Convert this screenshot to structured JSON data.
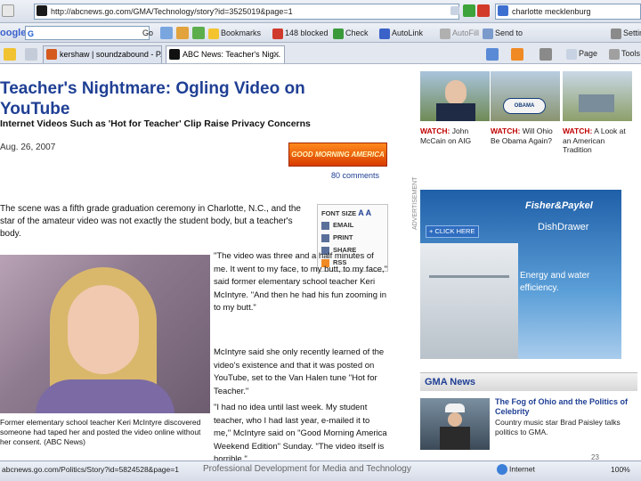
{
  "browser": {
    "url": "http://abcnews.go.com/GMA/Technology/story?id=3525019&page=1",
    "search_text": "charlotte mecklenburg",
    "toolbar": {
      "google_label": "oogle",
      "go_label": "Go",
      "bookmarks_label": "Bookmarks",
      "blocked_label": "148 blocked",
      "check_label": "Check",
      "autolink_label": "AutoLink",
      "autofill_label": "AutoFill",
      "sendto_label": "Send to",
      "settings_label": "Settin"
    },
    "tabs": [
      {
        "label": "kershaw | soundzabound - P..."
      },
      {
        "label": "ABC News: Teacher's Nig..."
      }
    ],
    "page_label": "Page",
    "tools_label": "Tools"
  },
  "article": {
    "headline": "Teacher's Nightmare: Ogling Video on YouTube",
    "subhead": "Internet Videos Such as 'Hot for Teacher' Clip Raise Privacy Concerns",
    "date": "Aug. 26, 2007",
    "gma_logo": "GOOD MORNING AMERICA",
    "comments": "80 comments",
    "lede": "The scene was a fifth grade graduation ceremony in Charlotte, N.C., and the star of the amateur video was not exactly the student body, but a teacher's body.",
    "para1": "\"The video was three and a half minutes of me. It went to my face, to my butt, to my face,\" said former elementary school teacher Keri McIntyre. \"And then he had his fun zooming in to my butt.\"",
    "para2": "McIntyre said she only recently learned of the video's existence and that it was posted on YouTube, set to the Van Halen tune \"Hot for Teacher.\"",
    "para3": "\"I had no idea until last week. My student teacher, who I had last year, e-mailed it to me,\" McIntyre said on \"Good Morning America Weekend Edition\" Sunday. \"The video itself is horrible,\"",
    "caption": "Former elementary school teacher Keri McIntyre discovered someone had taped her and posted the video online without her consent. (ABC News)",
    "tools": {
      "font_size": "FONT SIZE",
      "email": "EMAIL",
      "print": "PRINT",
      "share": "SHARE",
      "rss": "RSS"
    }
  },
  "sidebar": {
    "thumbs": [
      {
        "watch": "WATCH:",
        "text": "John McCain on AIG"
      },
      {
        "watch": "WATCH:",
        "text": "Will Ohio Be Obama Again?"
      },
      {
        "watch": "WATCH:",
        "text": "A Look at an American Tradition"
      }
    ],
    "advertisement_label": "ADVERTISEMENT",
    "ad": {
      "brand": "Fisher&Paykel",
      "click_here": "+ CLICK HERE",
      "product": "DishDrawer",
      "tagline": "Energy and water efficiency."
    },
    "gma_news_title": "GMA News",
    "news_headline": "The Fog of Ohio and the Politics of Celebrity",
    "news_text": "Country music star Brad Paisley talks politics to GMA."
  },
  "status": {
    "url": "abcnews.go.com/Politics/Story?id=5824528&page=1",
    "zone": "Internet",
    "zoom": "100%"
  },
  "footer": "Professional Development for Media and Technology",
  "slide_number": "23"
}
